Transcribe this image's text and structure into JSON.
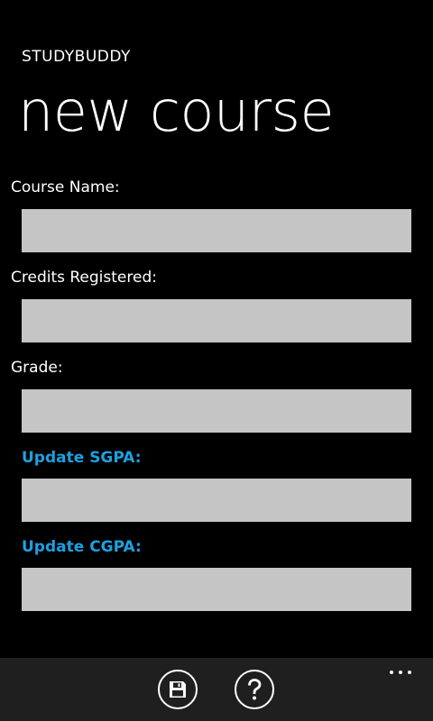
{
  "header": {
    "app_title": "STUDYBUDDY",
    "page_title": "new course"
  },
  "form": {
    "course_name": {
      "label": "Course Name:",
      "value": ""
    },
    "credits_registered": {
      "label": "Credits Registered:",
      "value": ""
    },
    "grade": {
      "label": "Grade:",
      "value": ""
    },
    "update_sgpa": {
      "label": "Update SGPA:",
      "value": ""
    },
    "update_cgpa": {
      "label": "Update CGPA:",
      "value": ""
    }
  },
  "app_bar": {
    "buttons": [
      {
        "icon": "save-icon"
      },
      {
        "icon": "help-icon"
      }
    ],
    "more_icon": "ellipsis-icon"
  },
  "colors": {
    "background": "#000000",
    "accent": "#1ba1e2",
    "input_background": "#c5c5c5",
    "app_bar_background": "#1f1f1f",
    "text": "#ffffff"
  }
}
